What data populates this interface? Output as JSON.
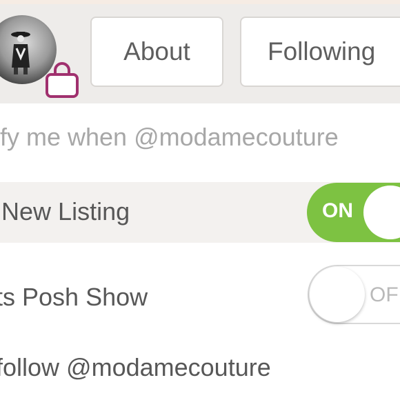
{
  "header": {
    "about_label": "About",
    "following_label": "Following"
  },
  "notifications": {
    "intro_text": "tify me when @modamecouture",
    "items": [
      {
        "label": "d New Listing",
        "toggle_text": "ON",
        "enabled": true
      },
      {
        "label": "arts Posh Show",
        "toggle_text": "OFF",
        "enabled": false
      }
    ],
    "follow_text": "follow @modamecouture"
  },
  "colors": {
    "toggle_on": "#7dc242",
    "bag_icon": "#a0306e",
    "header_bg": "#eeecea"
  },
  "icons": {
    "avatar": "profile-avatar",
    "badge": "shopping-bag-icon"
  }
}
